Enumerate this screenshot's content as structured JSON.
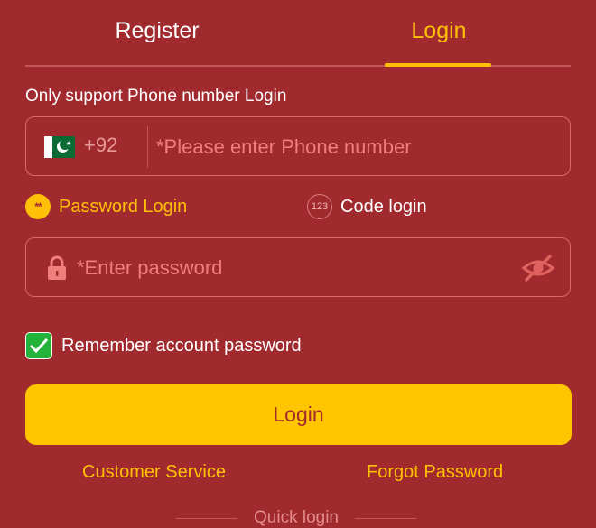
{
  "tabs": {
    "register": "Register",
    "login": "Login",
    "active": "login"
  },
  "hint": "Only support Phone number Login",
  "phone": {
    "country_code": "+92",
    "placeholder": "*Please enter Phone number",
    "value": "",
    "flag_icon": "pakistan-flag-icon"
  },
  "login_modes": {
    "password": {
      "label": "Password Login",
      "icon": "password-dots-icon",
      "icon_text": "**",
      "active": true
    },
    "code": {
      "label": "Code login",
      "icon": "code-123-icon",
      "icon_text": "123",
      "active": false
    }
  },
  "password": {
    "placeholder": "*Enter password",
    "value": "",
    "lock_icon": "lock-icon",
    "toggle_icon": "eye-slash-icon"
  },
  "remember": {
    "label": "Remember account password",
    "checked": true
  },
  "login_button": "Login",
  "links": {
    "customer_service": "Customer Service",
    "forgot_password": "Forgot Password"
  },
  "quick_login": "Quick login",
  "colors": {
    "background": "#a12a2e",
    "accent": "#ffc107",
    "checkbox": "#23b33a",
    "placeholder": "#ee7f7d"
  }
}
